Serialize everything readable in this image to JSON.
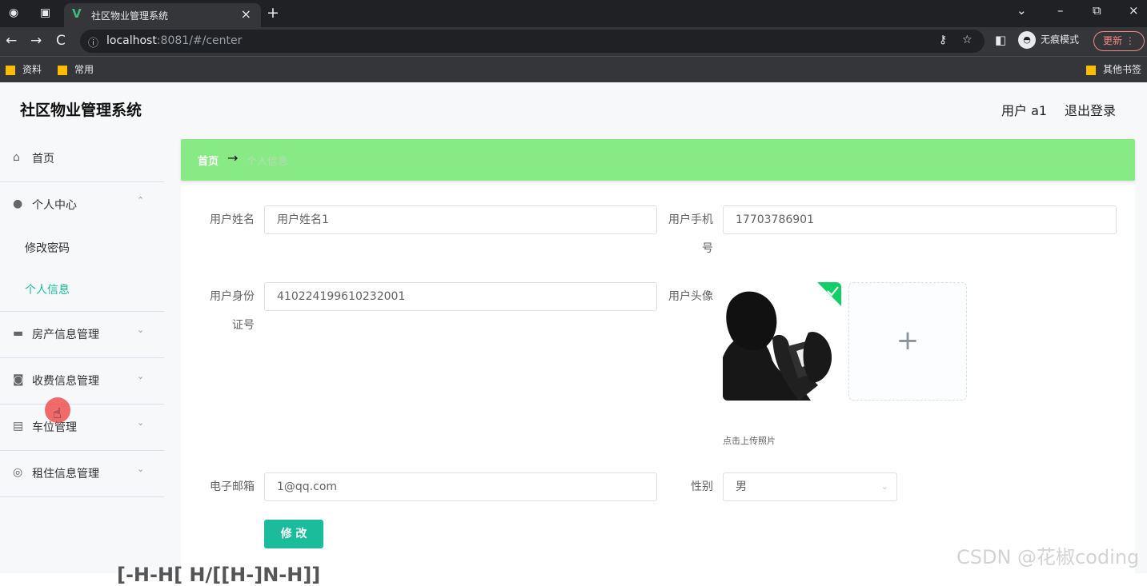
{
  "browser": {
    "tab_title": "社区物业管理系统",
    "tab_favicon": "V",
    "tab_close": "×",
    "new_tab": "+",
    "window_controls": [
      "⌄",
      "–",
      "⧉",
      "×"
    ],
    "nav": [
      "←",
      "→",
      "C"
    ],
    "url_host": "localhost",
    "url_path": ":8081/#/center",
    "incognito_label": "无痕模式",
    "update_label": "更新",
    "update_menu": "⋮",
    "bookmarks": [
      "资料",
      "常用"
    ],
    "other_bookmarks": "其他书签"
  },
  "header": {
    "title": "社区物业管理系统",
    "user": "用户 a1",
    "logout": "退出登录"
  },
  "sidebar": {
    "home": "首页",
    "personal_center": "个人中心",
    "change_password": "修改密码",
    "personal_info": "个人信息",
    "property": "房产信息管理",
    "charges": "收费信息管理",
    "parking": "车位管理",
    "rental": "租住信息管理"
  },
  "breadcrumb": {
    "home": "首页",
    "arrow": "→",
    "current": "个人信息"
  },
  "form": {
    "name_label": "用户姓名",
    "name_value": "用户姓名1",
    "phone_label": "用户手机号",
    "phone_value": "17703786901",
    "id_label": "用户身份证号",
    "id_value": "410224199610232001",
    "avatar_label": "用户头像",
    "upload_hint": "点击上传照片",
    "upload_plus": "+",
    "email_label": "电子邮箱",
    "email_value": "1@qq.com",
    "gender_label": "性别",
    "gender_value": "男",
    "submit": "修 改"
  },
  "watermark": "CSDN @花椒coding",
  "bottom_overlay": "[-H-H[ H/[[H-]N-H]]"
}
